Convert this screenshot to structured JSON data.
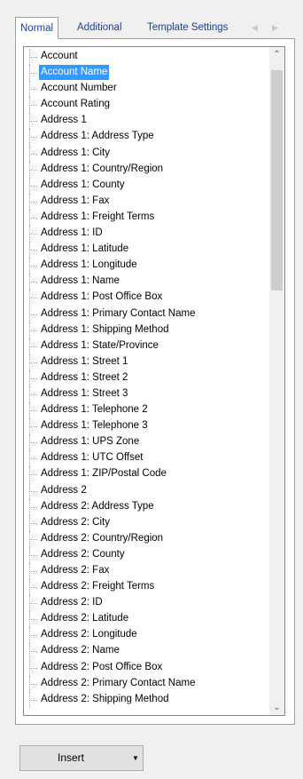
{
  "tabs": {
    "items": [
      {
        "label": "Normal",
        "active": true
      },
      {
        "label": "Additional",
        "active": false
      },
      {
        "label": "Template Settings",
        "active": false
      }
    ],
    "scroll_left_icon": "chevron-left-icon",
    "scroll_right_icon": "chevron-right-icon"
  },
  "field_tree": {
    "selected": "Account Name",
    "items": [
      "Account",
      "Account Name",
      "Account Number",
      "Account Rating",
      "Address 1",
      "Address 1: Address Type",
      "Address 1: City",
      "Address 1: Country/Region",
      "Address 1: County",
      "Address 1: Fax",
      "Address 1: Freight Terms",
      "Address 1: ID",
      "Address 1: Latitude",
      "Address 1: Longitude",
      "Address 1: Name",
      "Address 1: Post Office Box",
      "Address 1: Primary Contact Name",
      "Address 1: Shipping Method",
      "Address 1: State/Province",
      "Address 1: Street 1",
      "Address 1: Street 2",
      "Address 1: Street 3",
      "Address 1: Telephone 2",
      "Address 1: Telephone 3",
      "Address 1: UPS Zone",
      "Address 1: UTC Offset",
      "Address 1: ZIP/Postal Code",
      "Address 2",
      "Address 2: Address Type",
      "Address 2: City",
      "Address 2: Country/Region",
      "Address 2: County",
      "Address 2: Fax",
      "Address 2: Freight Terms",
      "Address 2: ID",
      "Address 2: Latitude",
      "Address 2: Longitude",
      "Address 2: Name",
      "Address 2: Post Office Box",
      "Address 2: Primary Contact Name",
      "Address 2: Shipping Method"
    ],
    "scrollbar": {
      "up_icon": "chevron-up-icon",
      "down_icon": "chevron-down-icon"
    }
  },
  "insert_button": {
    "label": "Insert",
    "dropdown_icon": "caret-down-icon"
  },
  "colors": {
    "selection_bg": "#3399ff",
    "tab_text": "#1a3e9a"
  }
}
